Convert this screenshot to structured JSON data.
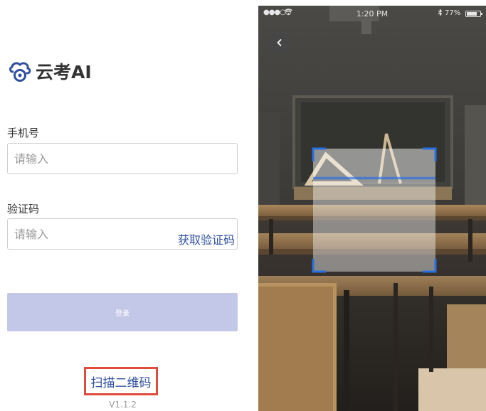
{
  "login": {
    "brand_name": "云考AI",
    "phone_label": "手机号",
    "phone_placeholder": "请输入",
    "code_label": "验证码",
    "code_placeholder": "请输入",
    "get_code_label": "获取验证码",
    "login_button_label": "登录",
    "scan_link_label": "扫描二维码",
    "version": "V1.1.2",
    "brand_color": "#2f4f9e",
    "highlight_color": "#e14b3b"
  },
  "scanner": {
    "status_bar": {
      "signal": "●●●○○",
      "time": "1:20 PM",
      "battery_percent": "77%"
    },
    "back_icon": "chevron-left-icon",
    "frame_color": "#2a6fe0"
  }
}
